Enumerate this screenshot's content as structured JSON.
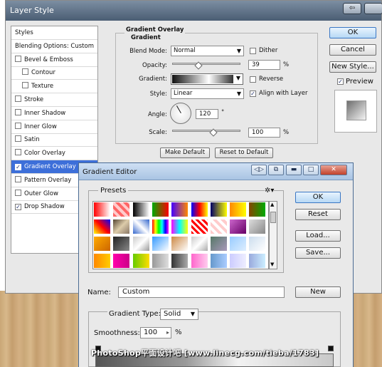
{
  "layer_style": {
    "title": "Layer Style",
    "styles_list": [
      {
        "label": "Styles",
        "type": "header"
      },
      {
        "label": "Blending Options: Custom",
        "type": "header"
      },
      {
        "label": "Bevel & Emboss",
        "checked": false
      },
      {
        "label": "Contour",
        "checked": false,
        "sub": true
      },
      {
        "label": "Texture",
        "checked": false,
        "sub": true
      },
      {
        "label": "Stroke",
        "checked": false
      },
      {
        "label": "Inner Shadow",
        "checked": false
      },
      {
        "label": "Inner Glow",
        "checked": false
      },
      {
        "label": "Satin",
        "checked": false
      },
      {
        "label": "Color Overlay",
        "checked": false
      },
      {
        "label": "Gradient Overlay",
        "checked": true,
        "selected": true
      },
      {
        "label": "Pattern Overlay",
        "checked": false
      },
      {
        "label": "Outer Glow",
        "checked": false
      },
      {
        "label": "Drop Shadow",
        "checked": true
      }
    ],
    "gradient_overlay": {
      "header": "Gradient Overlay",
      "sub_header": "Gradient",
      "blend_mode_label": "Blend Mode:",
      "blend_mode_value": "Normal",
      "dither_label": "Dither",
      "opacity_label": "Opacity:",
      "opacity_value": "39",
      "opacity_unit": "%",
      "opacity_level": 0.39,
      "gradient_label": "Gradient:",
      "reverse_label": "Reverse",
      "style_label": "Style:",
      "style_value": "Linear",
      "align_label": "Align with Layer",
      "angle_label": "Angle:",
      "angle_value": "120",
      "angle_unit": "°",
      "scale_label": "Scale:",
      "scale_value": "100",
      "scale_unit": "%",
      "make_default": "Make Default",
      "reset_default": "Reset to Default"
    },
    "buttons": {
      "ok": "OK",
      "cancel": "Cancel",
      "new_style": "New Style...",
      "preview": "Preview"
    }
  },
  "gradient_editor": {
    "title": "Gradient Editor",
    "presets_label": "Presets",
    "presets_menu_icon": "gear-icon",
    "buttons": {
      "ok": "OK",
      "reset": "Reset",
      "load": "Load...",
      "save": "Save...",
      "new": "New"
    },
    "name_label": "Name:",
    "name_value": "Custom",
    "gradient_type_label": "Gradient Type:",
    "gradient_type_value": "Solid",
    "smoothness_label": "Smoothness:",
    "smoothness_value": "100",
    "smoothness_unit": "%"
  },
  "watermark": "PhotoShop平面设计吧 [www.linecg.com/tieba/1783]"
}
